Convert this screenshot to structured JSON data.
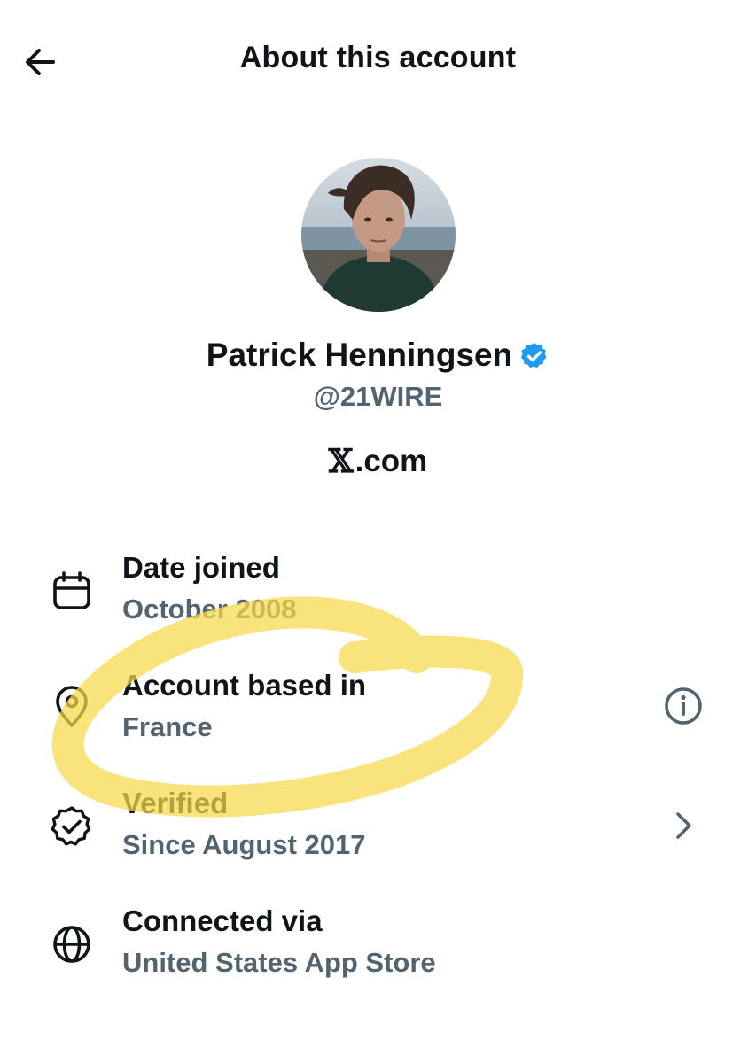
{
  "header": {
    "title": "About this account",
    "back_icon": "arrow-left-icon"
  },
  "profile": {
    "display_name": "Patrick Henningsen",
    "handle": "@21WIRE",
    "verified_icon": "verified-badge-icon",
    "verified_color": "#1d9bf0",
    "site_mark": "𝕏",
    "site_suffix": ".com"
  },
  "details": [
    {
      "icon": "calendar-icon",
      "label": "Date joined",
      "value": "October 2008"
    },
    {
      "icon": "location-pin-icon",
      "label": "Account based in",
      "value": "France",
      "action_icon": "info-icon"
    },
    {
      "icon": "verified-check-icon",
      "label": "Verified",
      "value": "Since August 2017",
      "action_icon": "chevron-right-icon"
    },
    {
      "icon": "globe-icon",
      "label": "Connected via",
      "value": "United States App Store"
    }
  ],
  "colors": {
    "text_primary": "#0f1419",
    "text_secondary": "#536471",
    "highlight": "#f7d84a"
  }
}
